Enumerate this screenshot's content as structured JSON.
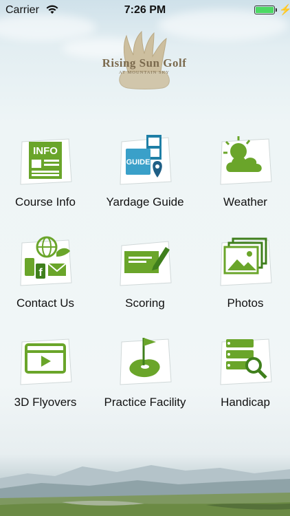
{
  "status_bar": {
    "carrier": "Carrier",
    "time": "7:26 PM"
  },
  "logo": {
    "name": "Rising Sun Golf",
    "subtitle": "AT MOUNTAIN SKY"
  },
  "menu": [
    {
      "label": "Course Info",
      "icon": "info-icon"
    },
    {
      "label": "Yardage Guide",
      "icon": "yardage-guide-icon"
    },
    {
      "label": "Weather",
      "icon": "weather-icon"
    },
    {
      "label": "Contact Us",
      "icon": "contact-icon"
    },
    {
      "label": "Scoring",
      "icon": "scoring-icon"
    },
    {
      "label": "Photos",
      "icon": "photos-icon"
    },
    {
      "label": "3D Flyovers",
      "icon": "video-icon"
    },
    {
      "label": "Practice Facility",
      "icon": "practice-flag-icon"
    },
    {
      "label": "Handicap",
      "icon": "handicap-icon"
    }
  ],
  "icon_texts": {
    "info": "INFO",
    "guide": "GUIDE"
  },
  "colors": {
    "accent_green": "#6aa52a",
    "dark_green": "#3f7f1c",
    "brand_tan": "#7b6a4e"
  }
}
